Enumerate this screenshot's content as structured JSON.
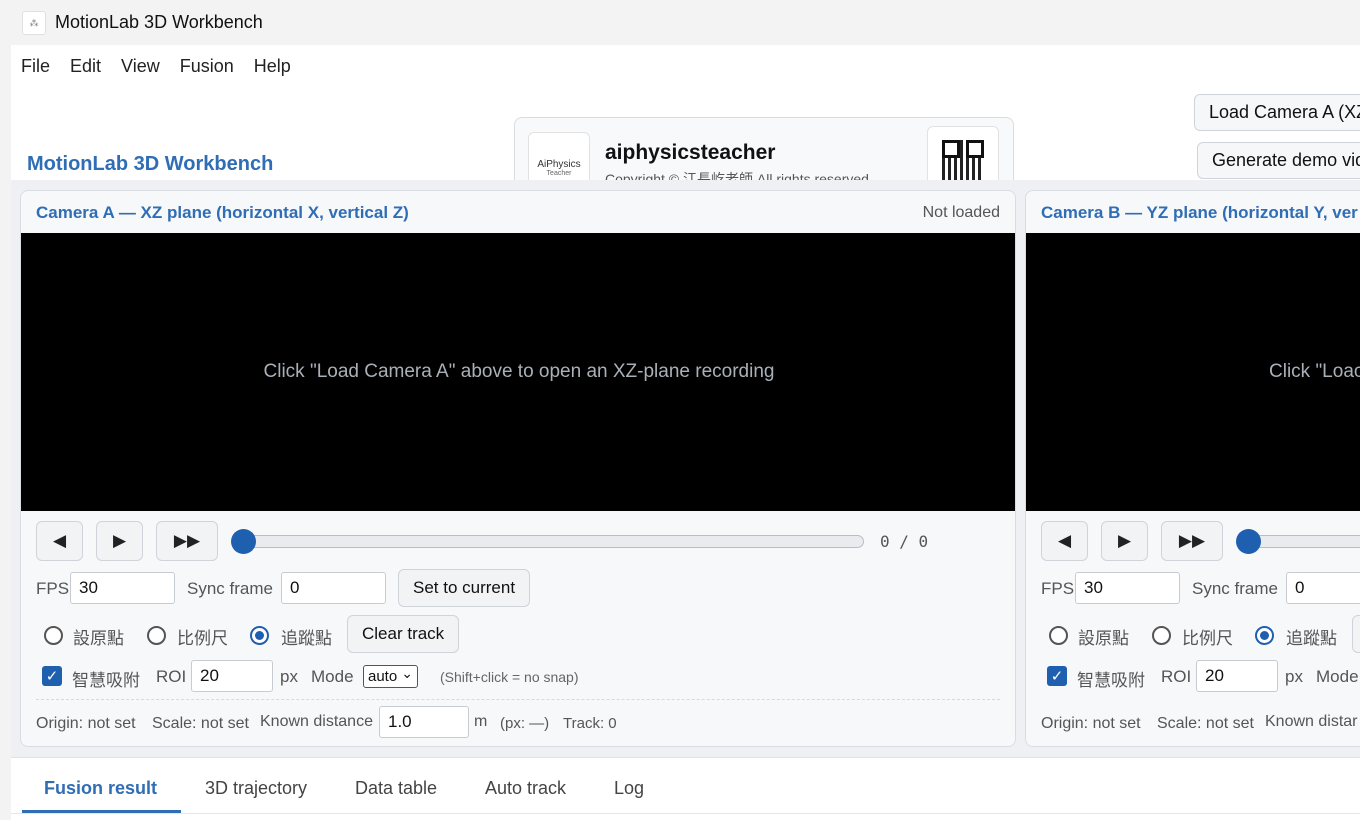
{
  "window": {
    "title": "MotionLab 3D Workbench",
    "icon": "app-logo-icon"
  },
  "menu": [
    "File",
    "Edit",
    "View",
    "Fusion",
    "Help"
  ],
  "header": {
    "heading": "MotionLab 3D Workbench",
    "brand": {
      "logo_line1": "AiPhysics",
      "logo_line2": "Teacher",
      "name": "aiphysicsteacher",
      "copyright": "Copyright © 江長屹老師 All rights reserved"
    },
    "load_camera_a": "Load Camera A (XZ",
    "generate_demo": "Generate demo vid"
  },
  "cameras": [
    {
      "title": "Camera A — XZ plane (horizontal X, vertical Z)",
      "status": "Not loaded",
      "hint": "Click \"Load Camera A\" above to open an XZ-plane recording",
      "frame_counter": "0 / 0",
      "fps_label": "FPS",
      "fps_value": "30",
      "sync_label": "Sync frame",
      "sync_value": "0",
      "set_current": "Set to current",
      "mode_origin": "設原點",
      "mode_scale": "比例尺",
      "mode_track": "追蹤點",
      "selected_mode": "追蹤點",
      "clear_track": "Clear track",
      "smart_snap": "智慧吸附",
      "smart_snap_checked": true,
      "roi_label": "ROI",
      "roi_value": "20",
      "px_label": "px",
      "mode_label": "Mode",
      "mode_value": "auto",
      "snap_hint": "(Shift+click = no snap)",
      "origin_status": "Origin: not set",
      "scale_status": "Scale: not set",
      "known_distance_label": "Known distance",
      "known_distance_value": "1.0",
      "unit": "m",
      "px_readout": "(px: —)",
      "track_count": "Track: 0"
    },
    {
      "title": "Camera B — YZ plane (horizontal Y, ver",
      "hint": "Click \"Loac",
      "fps_label": "FPS",
      "fps_value": "30",
      "sync_label": "Sync frame",
      "sync_value": "0",
      "mode_origin": "設原點",
      "mode_scale": "比例尺",
      "mode_track": "追蹤點",
      "smart_snap": "智慧吸附",
      "roi_label": "ROI",
      "roi_value": "20",
      "px_label": "px",
      "mode_label": "Mode",
      "origin_status": "Origin: not set",
      "scale_status": "Scale: not set",
      "known_distance_label": "Known distar"
    }
  ],
  "controls": {
    "prev_glyph": "◀",
    "play_glyph": "▶",
    "ff_glyph": "▶▶",
    "check_glyph": "✓",
    "chevron_glyph": "⌄"
  },
  "tabs": [
    "Fusion result",
    "3D trajectory",
    "Data table",
    "Auto track",
    "Log"
  ],
  "active_tab": "Fusion result",
  "colors": {
    "accent": "#2f6db5",
    "thumb": "#1f5fb0",
    "video_bg": "#000000"
  }
}
